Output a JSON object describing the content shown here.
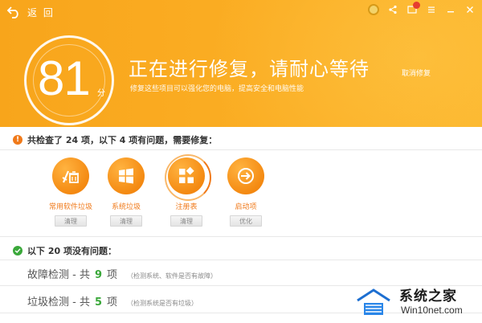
{
  "header": {
    "back_label": "返 回",
    "score": "81",
    "score_unit": "分",
    "headline": "正在进行修复，请耐心等待",
    "subline": "修复这些项目可以强化您的电脑，提高安全和电脑性能",
    "cancel_label": "取消修复",
    "colors": {
      "primary": "#f8a51b",
      "accent": "#f07a1a"
    }
  },
  "issues": {
    "summary": "共检查了 24 项，以下 4 项有问题，需要修复：",
    "tiles": [
      {
        "icon": "broom-trash-icon",
        "label": "常用软件垃圾",
        "button": "清理"
      },
      {
        "icon": "windows-logo-icon",
        "label": "系统垃圾",
        "button": "清理"
      },
      {
        "icon": "registry-blocks-icon",
        "label": "注册表",
        "button": "清理"
      },
      {
        "icon": "startup-arrow-icon",
        "label": "启动项",
        "button": "优化"
      }
    ]
  },
  "ok": {
    "summary": "以下 20 项没有问题：",
    "rows": [
      {
        "title": "故障检测 - 共",
        "count": "9",
        "unit": "项",
        "note": "（检测系统、软件是否有故障）"
      },
      {
        "title": "垃圾检测 - 共",
        "count": "5",
        "unit": "项",
        "note": "（检测系统是否有垃圾）"
      }
    ]
  },
  "watermark": {
    "line1": "系统之家",
    "line2": "Win10net.com"
  }
}
